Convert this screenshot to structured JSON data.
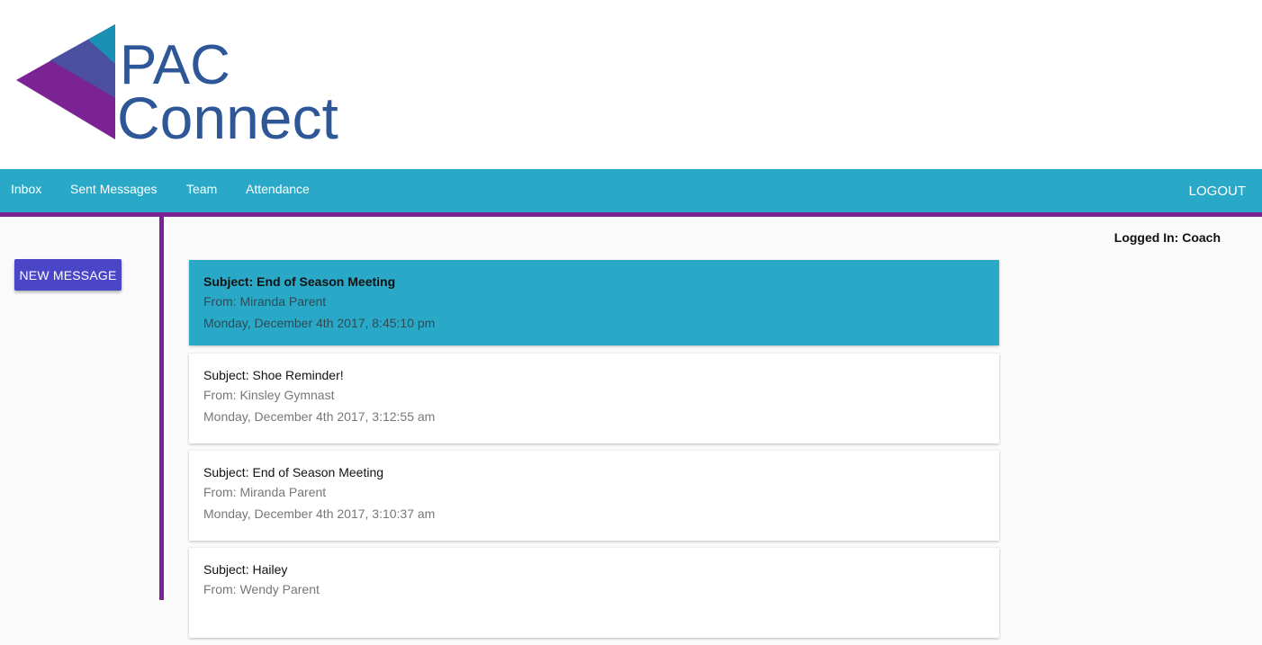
{
  "brand": {
    "line1": "PAC",
    "line2": "Connect",
    "colors": {
      "text": "#2e5797",
      "purple": "#7b2294",
      "indigo": "#4b4fa0",
      "teal": "#1b90b5"
    }
  },
  "nav": {
    "items": [
      {
        "label": "Inbox"
      },
      {
        "label": "Sent Messages"
      },
      {
        "label": "Team"
      },
      {
        "label": "Attendance"
      }
    ],
    "logout_label": "LOGOUT",
    "color": "#29a9c7",
    "border_color": "#7b2294"
  },
  "sidebar": {
    "new_message_label": "NEW MESSAGE",
    "button_color": "#4b45c8"
  },
  "status": {
    "logged_in": "Logged In: Coach"
  },
  "messages": [
    {
      "subject": "Subject: End of Season Meeting",
      "from": "From: Miranda Parent",
      "date": "Monday, December 4th 2017, 8:45:10 pm",
      "selected": true
    },
    {
      "subject": "Subject: Shoe Reminder!",
      "from": "From: Kinsley Gymnast",
      "date": "Monday, December 4th 2017, 3:12:55 am",
      "selected": false
    },
    {
      "subject": "Subject: End of Season Meeting",
      "from": "From: Miranda Parent",
      "date": "Monday, December 4th 2017, 3:10:37 am",
      "selected": false
    },
    {
      "subject": "Subject: Hailey",
      "from": "From: Wendy Parent",
      "date": "",
      "selected": false
    }
  ]
}
